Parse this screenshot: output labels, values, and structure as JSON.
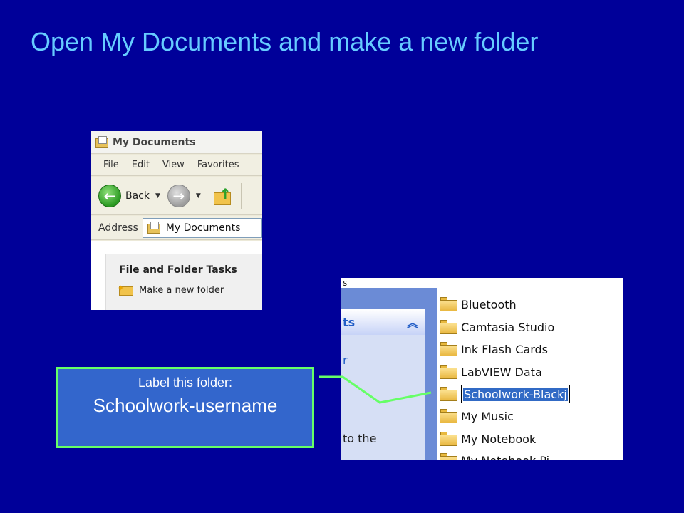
{
  "slide": {
    "title": "Open My Documents and make a new folder"
  },
  "window": {
    "title": "My Documents",
    "menu": [
      "File",
      "Edit",
      "View",
      "Favorites"
    ],
    "toolbar": {
      "back_label": "Back"
    },
    "address": {
      "label": "Address",
      "value": "My Documents"
    },
    "tasks": {
      "header": "File and Folder Tasks",
      "item": "Make a new folder"
    },
    "icons": [
      "my-documents-icon",
      "back-arrow-icon",
      "forward-arrow-icon",
      "folder-up-icon",
      "new-folder-icon"
    ]
  },
  "folder_view": {
    "top_fragment": "s",
    "left_panel": {
      "header_fragment": "ts",
      "collapse_glyph": "︽",
      "fragment_r": "r",
      "fragment_to_the": "to the"
    },
    "folders": [
      {
        "name": "Bluetooth"
      },
      {
        "name": "Camtasia Studio"
      },
      {
        "name": "Ink Flash Cards"
      },
      {
        "name": "LabVIEW Data"
      },
      {
        "name": "Schoolwork-Blackj",
        "renaming": true
      },
      {
        "name": "My Music"
      },
      {
        "name": "My Notebook"
      },
      {
        "name": "My Notebook Pi"
      }
    ]
  },
  "callout": {
    "line1": "Label this folder:",
    "line2": "Schoolwork-username",
    "border_color": "#66ff66",
    "fill_color": "#3366cc"
  },
  "colors": {
    "background": "#000099",
    "title": "#66ccff",
    "connector": "#66ff66"
  }
}
